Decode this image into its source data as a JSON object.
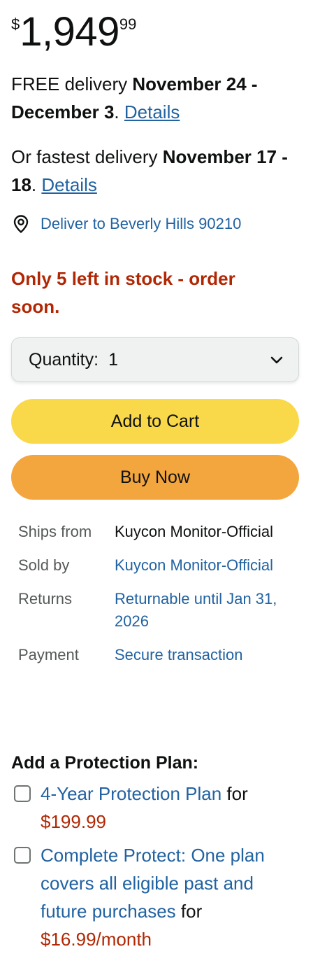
{
  "price": {
    "symbol": "$",
    "whole": "1,949",
    "fraction": "99"
  },
  "delivery": {
    "free_prefix": "FREE delivery ",
    "free_dates": "November 24 - December 3",
    "free_suffix": ".",
    "details_label": "Details",
    "fast_prefix": "Or fastest delivery ",
    "fast_dates": "November 17 - 18",
    "fast_suffix": ".",
    "fast_details_label": "Details"
  },
  "location": {
    "icon": "location-pin-icon",
    "text": "Deliver to Beverly Hills 90210"
  },
  "stock": {
    "text": "Only 5 left in stock - order soon.",
    "color": "#b12704"
  },
  "quantity": {
    "label": "Quantity:",
    "value": "1"
  },
  "buttons": {
    "add_to_cart": "Add to Cart",
    "buy_now": "Buy Now",
    "add_to_cart_color": "#f9d849",
    "buy_now_color": "#f4a63e"
  },
  "info_rows": [
    {
      "key": "Ships from",
      "value": "Kuycon Monitor-Official"
    },
    {
      "key": "Sold by",
      "value": "Kuycon Monitor-Official"
    },
    {
      "key": "Returns",
      "value": "Returnable until Jan 31, 2026"
    },
    {
      "key": "Payment",
      "value": "Secure transaction"
    }
  ],
  "protection": {
    "title": "Add a Protection Plan:",
    "plans": [
      {
        "name": "4-Year Protection Plan",
        "connector": " for",
        "price": "$199.99",
        "checked": false
      },
      {
        "name": "Complete Protect: One plan covers all eligible past and future purchases",
        "connector": " for",
        "price": "$16.99/month",
        "checked": false
      }
    ]
  },
  "colors": {
    "link": "#2162a1",
    "text": "#0f1111",
    "muted": "#565959"
  }
}
